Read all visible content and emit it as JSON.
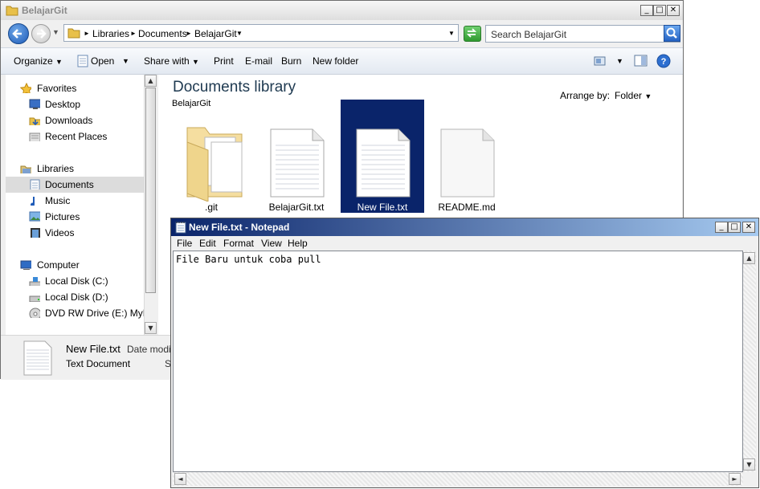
{
  "explorer": {
    "title": "BelajarGit",
    "breadcrumb": [
      "Libraries",
      "Documents",
      "BelajarGit"
    ],
    "search_placeholder": "Search BelajarGit",
    "toolbar": {
      "organize": "Organize",
      "open": "Open",
      "share_with": "Share with",
      "print": "Print",
      "email": "E-mail",
      "burn": "Burn",
      "new_folder": "New folder"
    },
    "nav": {
      "favorites": "Favorites",
      "desktop": "Desktop",
      "downloads": "Downloads",
      "recent_places": "Recent Places",
      "libraries": "Libraries",
      "documents": "Documents",
      "music": "Music",
      "pictures": "Pictures",
      "videos": "Videos",
      "computer": "Computer",
      "local_c": "Local Disk (C:)",
      "local_d": "Local Disk (D:)",
      "dvd": "DVD RW Drive (E:) MyDisc"
    },
    "library_title": "Documents library",
    "library_subtitle": "BelajarGit",
    "arrange_by_label": "Arrange by:",
    "arrange_by_value": "Folder",
    "files": [
      {
        "name": ".git",
        "type": "folder"
      },
      {
        "name": "BelajarGit.txt",
        "type": "text"
      },
      {
        "name": "New File.txt",
        "type": "text",
        "selected": true
      },
      {
        "name": "README.md",
        "type": "blank"
      }
    ],
    "details": {
      "name": "New File.txt",
      "type": "Text Document",
      "date_label": "Date modifi",
      "size_label": "S"
    }
  },
  "notepad": {
    "title": "New File.txt - Notepad",
    "menu": [
      "File",
      "Edit",
      "Format",
      "View",
      "Help"
    ],
    "content": "File Baru untuk coba pull"
  },
  "colors": {
    "selection": "#0a246a",
    "notepad_title_start": "#0a246a",
    "notepad_title_end": "#a6caf0",
    "toolbar_bg": "#e8eef5"
  }
}
